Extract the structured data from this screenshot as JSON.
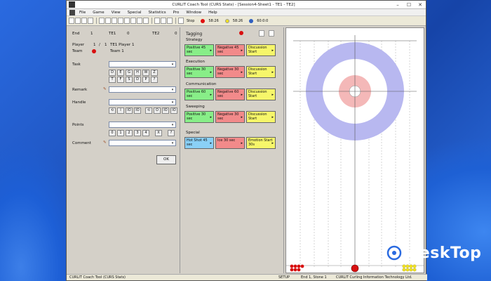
{
  "window": {
    "title": "CURLIT Coach Tool (CURS Stats) - [Session4-Sheet1 - TE1 - TE2]",
    "controls": {
      "minimize": "–",
      "maximize": "☐",
      "close": "✕"
    }
  },
  "menu": [
    "File",
    "Game",
    "View",
    "Special",
    "Statistics",
    "Pro",
    "Window",
    "Help"
  ],
  "toolbar": {
    "stop_label": "Stop",
    "clock1": "58:26",
    "clock2": "58:26",
    "clock3": "60:0:0",
    "clock1_color": "#e01010",
    "clock2_color": "#f0e020"
  },
  "left": {
    "end_label": "End",
    "end_value": "1",
    "te1_label": "TE1",
    "te1_score": "0",
    "te2_label": "TE2",
    "te2_score": "0",
    "player_label": "Player",
    "player_num": "1",
    "player_slash": "/",
    "player_num2": "1",
    "player_name": "TE1 Player 1",
    "team_label": "Team",
    "team_name": "Team 1",
    "task_label": "Task",
    "task_buttons_row1": [
      "D",
      "E",
      "G",
      "H",
      "W",
      "Z"
    ],
    "task_buttons_row2": [
      "T",
      "F",
      "S",
      "D",
      "P",
      "?"
    ],
    "remark_label": "Remark",
    "handle_label": "Handle",
    "handle_buttons": [
      "⟲",
      "I",
      "IO",
      "IO",
      "⟲",
      "O",
      "IO",
      "IO"
    ],
    "points_label": "Points",
    "points_buttons": [
      "0",
      "1",
      "2",
      "3",
      "4",
      "X",
      "?"
    ],
    "comment_label": "Comment",
    "ok_label": "OK"
  },
  "tagging": {
    "title": "Tagging",
    "categories": [
      {
        "name": "Strategy",
        "buttons": [
          {
            "label": "Positive 45 sec",
            "color": "green"
          },
          {
            "label": "Negative 45 sec",
            "color": "red"
          },
          {
            "label": "Discussion Start",
            "color": "yellow"
          }
        ]
      },
      {
        "name": "Execution",
        "buttons": [
          {
            "label": "Positive 30 sec",
            "color": "green"
          },
          {
            "label": "Negative 30 sec",
            "color": "red"
          },
          {
            "label": "Discussion Start",
            "color": "yellow"
          }
        ]
      },
      {
        "name": "Communication",
        "buttons": [
          {
            "label": "Positive 60 sec",
            "color": "green"
          },
          {
            "label": "Negative 60 sec",
            "color": "red"
          },
          {
            "label": "Discussion Start",
            "color": "yellow"
          }
        ]
      },
      {
        "name": "Sweeping",
        "buttons": [
          {
            "label": "Positive 30 sec",
            "color": "green"
          },
          {
            "label": "Negative 30 sec",
            "color": "red"
          },
          {
            "label": "Discussion Start",
            "color": "yellow"
          }
        ]
      },
      {
        "name": "Special",
        "buttons": [
          {
            "label": "Hot Shot 45 sec",
            "color": "blue"
          },
          {
            "label": "Ice 30 sec",
            "color": "red"
          },
          {
            "label": "Emotion Start 30s",
            "color": "yellow"
          }
        ]
      }
    ]
  },
  "status": {
    "app": "CURLIT Coach Tool (CURS Stats)",
    "setup": "SETUP",
    "position": "End 1, Stone 1",
    "company": "CURLIT Curling Information Technology Ltd."
  },
  "watermark": "4eskTop",
  "colors": {
    "house_outer": "#b8b8f0",
    "house_inner": "#f4b8b8",
    "stone_red": "#d81010",
    "stone_yellow": "#f0e020"
  }
}
